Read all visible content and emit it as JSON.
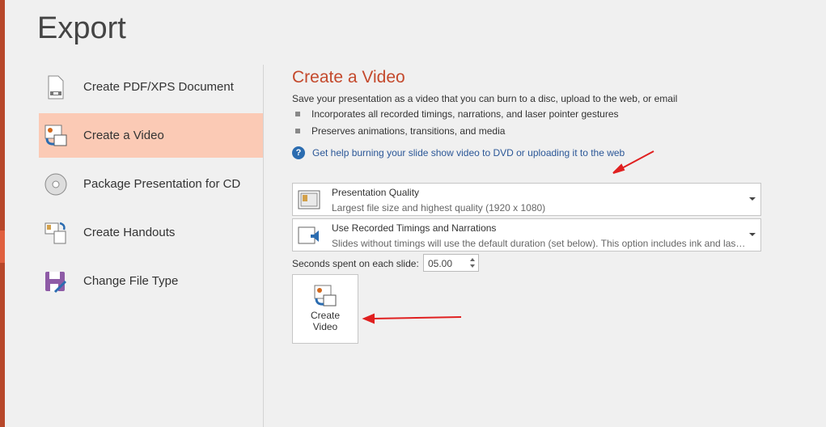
{
  "page_title": "Export",
  "nav": [
    {
      "label": "Create PDF/XPS Document",
      "icon": "pdf-document-icon"
    },
    {
      "label": "Create a Video",
      "icon": "video-icon",
      "selected": true
    },
    {
      "label": "Package Presentation for CD",
      "icon": "cd-icon"
    },
    {
      "label": "Create Handouts",
      "icon": "handouts-icon"
    },
    {
      "label": "Change File Type",
      "icon": "save-file-icon"
    }
  ],
  "main": {
    "title": "Create a Video",
    "description": "Save your presentation as a video that you can burn to a disc, upload to the web, or email",
    "bullets": [
      "Incorporates all recorded timings, narrations, and laser pointer gestures",
      "Preserves animations, transitions, and media"
    ],
    "help_link": "Get help burning your slide show video to DVD or uploading it to the web",
    "quality": {
      "title": "Presentation Quality",
      "subtitle": "Largest file size and highest quality (1920 x 1080)"
    },
    "timings": {
      "title": "Use Recorded Timings and Narrations",
      "subtitle": "Slides without timings will use the default duration (set below). This option includes ink and laser pointer gestures."
    },
    "seconds_label": "Seconds spent on each slide:",
    "seconds_value": "05.00",
    "create_button": {
      "line1": "Create",
      "line2": "Video"
    }
  },
  "colors": {
    "accent": "#c4492c",
    "selected": "#fbcab5",
    "annotation": "#e02020"
  }
}
